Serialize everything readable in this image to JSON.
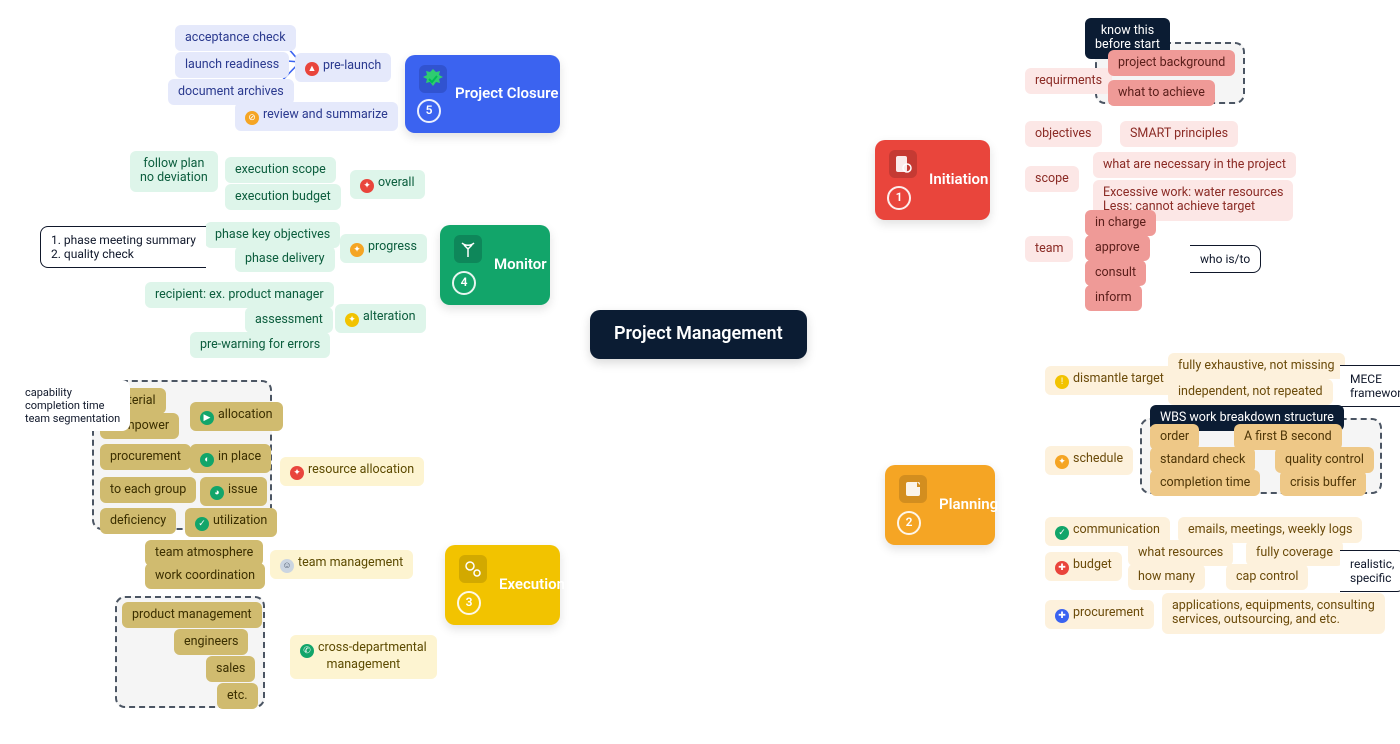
{
  "center": "Project Management",
  "phases": {
    "initiation": {
      "num": "1",
      "label": "Initiation"
    },
    "planning": {
      "num": "2",
      "label": "Planning"
    },
    "execution": {
      "num": "3",
      "label": "Execution"
    },
    "monitor": {
      "num": "4",
      "label": "Monitor"
    },
    "closure": {
      "num": "5",
      "label": "Project Closure"
    }
  },
  "initiation": {
    "requirements": "requirments",
    "req_children": [
      "project background",
      "what to achieve"
    ],
    "objectives": "objectives",
    "objectives_note": "SMART principles",
    "scope": "scope",
    "scope_children": [
      "what are necessary in the project",
      "Excessive work: water resources\nLess: cannot achieve target"
    ],
    "team": "team",
    "team_children": [
      "in charge",
      "approve",
      "consult",
      "inform"
    ],
    "know_before": "know this\nbefore start",
    "who_is": "who is/to"
  },
  "planning": {
    "dismantle": "dismantle target",
    "dismantle_children": [
      "fully exhaustive, not missing",
      "independent, not repeated"
    ],
    "schedule": "schedule",
    "sched_order": "order",
    "sched_order_v": "A first B second",
    "sched_std": "standard check",
    "sched_std_v": "quality control",
    "sched_time": "completion time",
    "sched_time_v": "crisis buffer",
    "wbs": "WBS work breakdown structure",
    "communication": "communication",
    "communication_v": "emails, meetings, weekly logs",
    "budget": "budget",
    "budget_what": "what resources",
    "budget_what_v": "fully coverage",
    "budget_how": "how many",
    "budget_how_v": "cap control",
    "procurement": "procurement",
    "procurement_v": "applications, equipments, consulting\nservices, outsourcing, and etc.",
    "mece": "MECE framework",
    "realistic": "realistic, specific"
  },
  "execution": {
    "resource": "resource allocation",
    "allocation": "allocation",
    "alloc_children": [
      "material",
      "manpower"
    ],
    "in_place": "in place",
    "in_place_v": "procurement",
    "issue": "issue",
    "issue_v": "to each group",
    "utilization": "utilization",
    "utilization_v": "deficiency",
    "team_mgmt": "team management",
    "team_children": [
      "team atmosphere",
      "work coordination"
    ],
    "cross_dept": "cross-departmental\nmanagement",
    "cross_children": [
      "product management",
      "engineers",
      "sales",
      "etc."
    ],
    "cap_note": "capability\ncompletion time\nteam segmentation"
  },
  "monitor": {
    "overall": "overall",
    "overall_children": [
      "execution scope",
      "execution budget"
    ],
    "overall_note": "follow plan\nno deviation",
    "progress": "progress",
    "progress_children": [
      "phase key objectives",
      "phase delivery"
    ],
    "progress_note": "1. phase meeting summary\n2. quality check",
    "alteration": "alteration",
    "alt_children": [
      "recipient: ex. product manager",
      "assessment",
      "pre-warning for errors"
    ]
  },
  "closure": {
    "prelaunch": "pre-launch",
    "pre_children": [
      "acceptance check",
      "launch readiness",
      "document archives"
    ],
    "review": "review and summarize"
  }
}
